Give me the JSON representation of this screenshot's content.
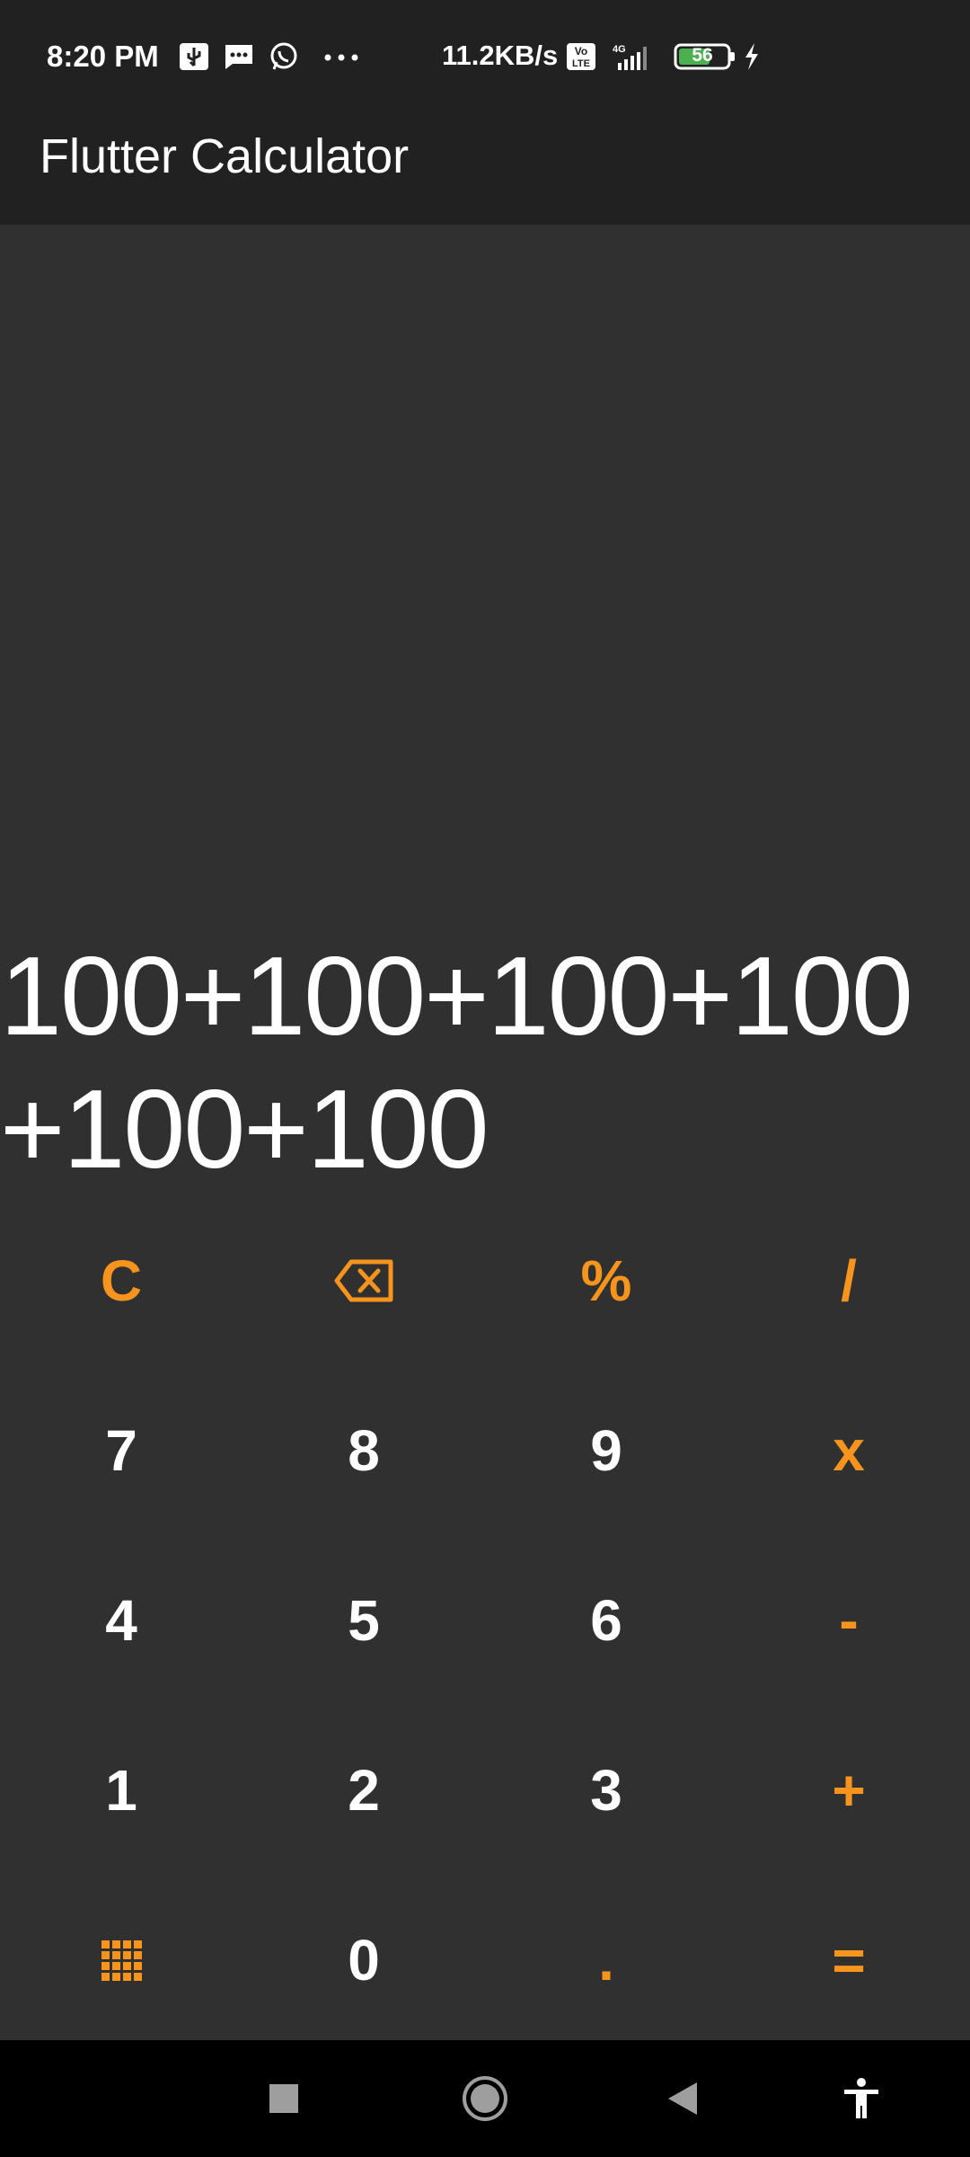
{
  "status_bar": {
    "time": "8:20 PM",
    "net_speed": "11.2KB/s",
    "network_type": "4G",
    "volte_label": "Vo LTE",
    "battery_percent": "56",
    "icons": [
      "usb-icon",
      "message-icon",
      "whatsapp-icon",
      "more-dots-icon",
      "volte-icon",
      "signal-icon",
      "battery-icon",
      "charging-icon"
    ]
  },
  "app_bar": {
    "title": "Flutter Calculator"
  },
  "display": {
    "expression": "100+100+100+100+100+100"
  },
  "keypad": {
    "row1": {
      "clear": "C",
      "backspace_icon": "backspace-icon",
      "percent": "%",
      "divide": "/"
    },
    "row2": {
      "k7": "7",
      "k8": "8",
      "k9": "9",
      "multiply": "x"
    },
    "row3": {
      "k4": "4",
      "k5": "5",
      "k6": "6",
      "minus": "-"
    },
    "row4": {
      "k1": "1",
      "k2": "2",
      "k3": "3",
      "plus": "+"
    },
    "row5": {
      "grid_icon": "grid-icon",
      "k0": "0",
      "dot": ".",
      "equals": "="
    }
  },
  "colors": {
    "accent": "#f7941d",
    "background": "#303030",
    "app_bar": "#212121",
    "text": "#ffffff",
    "battery_fill": "#4caf50"
  },
  "nav_bar": {
    "icons": [
      "recents-icon",
      "home-icon",
      "back-icon",
      "accessibility-icon"
    ]
  }
}
